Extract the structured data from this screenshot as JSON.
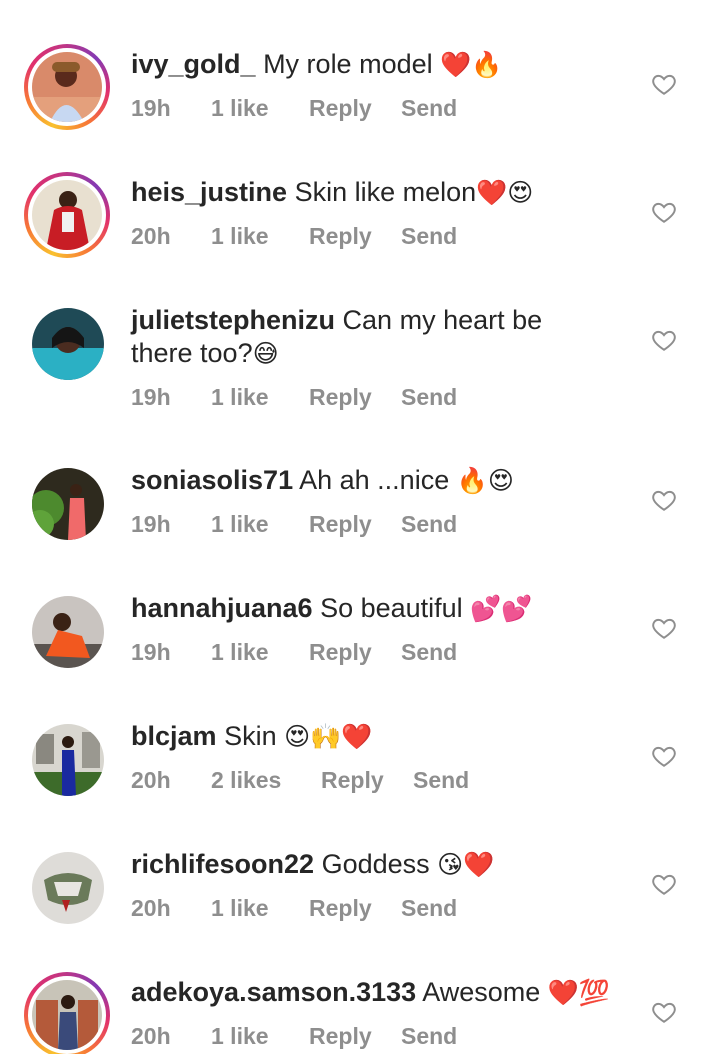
{
  "comments": [
    {
      "username": "ivy_gold_",
      "text": "My role model",
      "emoji": "❤️🔥",
      "time": "19h",
      "likes": "1 like",
      "reply": "Reply",
      "send": "Send",
      "story_ring": true
    },
    {
      "username": "heis_justine",
      "text": "Skin like melon",
      "emoji": "❤️😍",
      "time": "20h",
      "likes": "1 like",
      "reply": "Reply",
      "send": "Send",
      "story_ring": true
    },
    {
      "username": "julietstephenizu",
      "text": "Can my heart be there too?",
      "emoji": "😅",
      "time": "19h",
      "likes": "1 like",
      "reply": "Reply",
      "send": "Send",
      "story_ring": false
    },
    {
      "username": "soniasolis71",
      "text": "Ah ah ...nice",
      "emoji": "🔥😍",
      "time": "19h",
      "likes": "1 like",
      "reply": "Reply",
      "send": "Send",
      "story_ring": false
    },
    {
      "username": "hannahjuana6",
      "text": "So beautiful",
      "emoji": "💕💕",
      "time": "19h",
      "likes": "1 like",
      "reply": "Reply",
      "send": "Send",
      "story_ring": false
    },
    {
      "username": "blcjam",
      "text": "Skin",
      "emoji": "😍🙌❤️",
      "time": "20h",
      "likes": "2 likes",
      "reply": "Reply",
      "send": "Send",
      "story_ring": false
    },
    {
      "username": "richlifesoon22",
      "text": "Goddess",
      "emoji": "😘❤️",
      "time": "20h",
      "likes": "1 like",
      "reply": "Reply",
      "send": "Send",
      "story_ring": false
    },
    {
      "username": "adekoya.samson.3133",
      "text": "Awesome",
      "emoji": "❤️💯",
      "time": "20h",
      "likes": "1 like",
      "reply": "Reply",
      "send": "Send",
      "story_ring": true
    }
  ],
  "colors": {
    "text": "#262626",
    "meta": "#8e8e8e",
    "heart_outline": "#8e8e8e"
  },
  "icons": {
    "like": "heart-outline-icon"
  }
}
